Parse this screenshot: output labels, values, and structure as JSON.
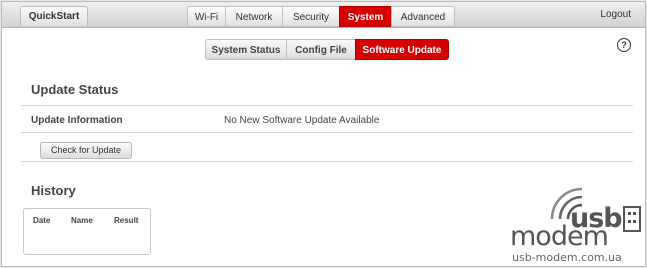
{
  "topbar": {
    "quickstart_label": "QuickStart",
    "tabs": [
      {
        "label": "Wi-Fi",
        "active": false
      },
      {
        "label": "Network",
        "active": false
      },
      {
        "label": "Security",
        "active": false
      },
      {
        "label": "System",
        "active": true
      },
      {
        "label": "Advanced",
        "active": false
      }
    ],
    "logout_label": "Logout"
  },
  "help": {
    "icon": "help-icon",
    "glyph": "?"
  },
  "subtabs": [
    {
      "label": "System Status",
      "active": false
    },
    {
      "label": "Config File",
      "active": false
    },
    {
      "label": "Software Update",
      "active": true
    }
  ],
  "update_status": {
    "title": "Update Status",
    "info_label": "Update Information",
    "info_value": "No New Software Update Available",
    "check_button": "Check for Update"
  },
  "history": {
    "title": "History",
    "columns": [
      "Date",
      "Name",
      "Result"
    ]
  },
  "watermark": {
    "usb": "usb",
    "modem": "modem",
    "url": "usb-modem.com.ua"
  },
  "colors": {
    "accent": "#d60000",
    "background": "#ffffff"
  }
}
